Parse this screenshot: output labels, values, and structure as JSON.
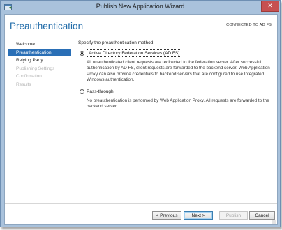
{
  "window": {
    "title": "Publish New Application Wizard",
    "close_glyph": "✕",
    "minimize_glyph": "—"
  },
  "header": {
    "title": "Preauthentication",
    "connection_status": "CONNECTED TO AD FS"
  },
  "nav": {
    "items": [
      {
        "label": "Welcome",
        "state": "normal"
      },
      {
        "label": "Preauthentication",
        "state": "active"
      },
      {
        "label": "Relying Party",
        "state": "normal"
      },
      {
        "label": "Publishing Settings",
        "state": "disabled"
      },
      {
        "label": "Confirmation",
        "state": "disabled"
      },
      {
        "label": "Results",
        "state": "disabled"
      }
    ]
  },
  "main": {
    "prompt": "Specify the preauthentication method:",
    "options": [
      {
        "label": "Active Directory Federation Services (AD FS)",
        "selected": true,
        "description": "All unauthenticated client requests are redirected to the federation server. After successful authentication by AD FS, client requests are forwarded to the backend server. Web Application Proxy can also provide credentials to backend servers that are configured to use Integrated Windows authentication."
      },
      {
        "label": "Pass-through",
        "selected": false,
        "description": "No preauthentication is performed by Web Application Proxy. All requests are forwarded to the backend server."
      }
    ]
  },
  "footer": {
    "previous_label": "< Previous",
    "next_label": "Next >",
    "publish_label": "Publish",
    "cancel_label": "Cancel"
  },
  "colors": {
    "accent": "#2a6fb6",
    "title_blue": "#1e6aa8",
    "frame": "#a9c2dc",
    "close_red": "#c75050"
  },
  "icons": {
    "app_icon": "wizard-window-icon",
    "close": "close-icon"
  }
}
